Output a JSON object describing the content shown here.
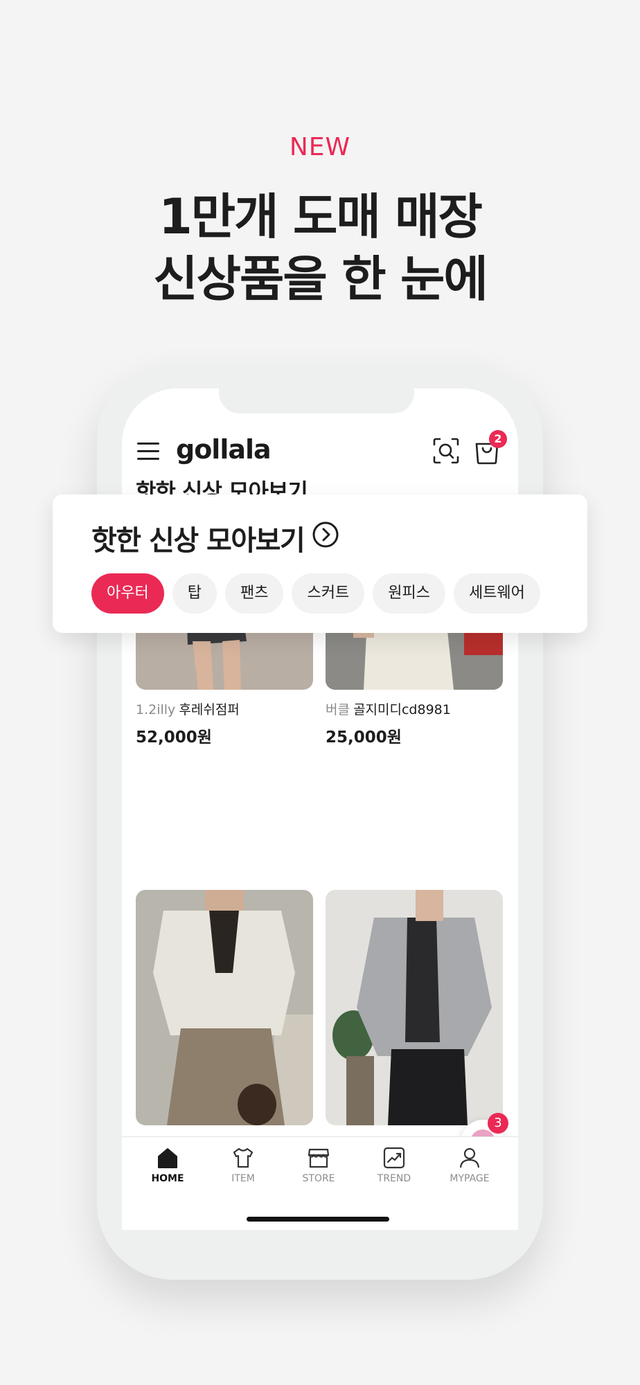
{
  "promo": {
    "tag": "NEW",
    "title_line1": "1만개 도매 매장",
    "title_line2": "신상품을 한 눈에"
  },
  "header": {
    "logo": "gollala",
    "cart_count": "2"
  },
  "section": {
    "title": "핫한 신상 모아보기"
  },
  "categories": [
    {
      "label": "아우터",
      "active": true
    },
    {
      "label": "탑",
      "active": false
    },
    {
      "label": "팬츠",
      "active": false
    },
    {
      "label": "스커트",
      "active": false
    },
    {
      "label": "원피스",
      "active": false
    },
    {
      "label": "세트웨어",
      "active": false
    }
  ],
  "products": [
    {
      "brand": "1.2illy",
      "name": "후레쉬점퍼",
      "price": "52,000원"
    },
    {
      "brand": "버클",
      "name": "골지미디cd8981",
      "price": "25,000원"
    }
  ],
  "chat": {
    "badge": "3"
  },
  "bottom_nav": [
    {
      "label": "HOME",
      "icon": "home-icon",
      "active": true
    },
    {
      "label": "ITEM",
      "icon": "shirt-icon",
      "active": false
    },
    {
      "label": "STORE",
      "icon": "store-icon",
      "active": false
    },
    {
      "label": "TREND",
      "icon": "trend-icon",
      "active": false
    },
    {
      "label": "MYPAGE",
      "icon": "person-icon",
      "active": false
    }
  ],
  "colors": {
    "accent": "#ea2a55",
    "background": "#f4f4f4",
    "text": "#1d1d1d"
  }
}
